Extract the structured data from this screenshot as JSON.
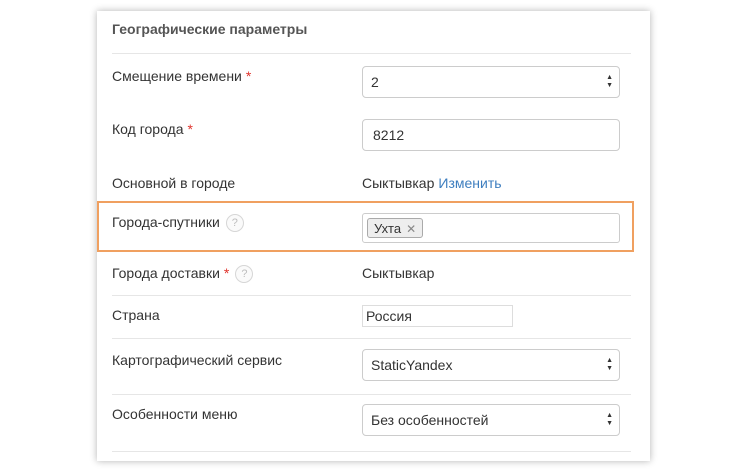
{
  "section": {
    "title": "Географические параметры"
  },
  "fields": {
    "time_offset": {
      "label": "Смещение времени",
      "required": "*",
      "value": "2"
    },
    "city_code": {
      "label": "Код города",
      "required": "*",
      "value": "8212"
    },
    "main_city": {
      "label": "Основной в городе",
      "value": "Сыктывкар",
      "link": "Изменить"
    },
    "satellite_cities": {
      "label": "Города-спутники",
      "help": "?",
      "tags": [
        "Ухта"
      ],
      "tag_remove": "✕"
    },
    "delivery_cities": {
      "label": "Города доставки",
      "required": "*",
      "help": "?",
      "value": "Сыктывкар"
    },
    "country": {
      "label": "Страна",
      "value": "Россия"
    },
    "map_service": {
      "label": "Картографический сервис",
      "value": "StaticYandex"
    },
    "menu_features": {
      "label": "Особенности меню",
      "value": "Без особенностей"
    }
  },
  "colors": {
    "accent_link": "#3d7ebf",
    "required": "#e0322b",
    "highlight": "#f0a060"
  }
}
